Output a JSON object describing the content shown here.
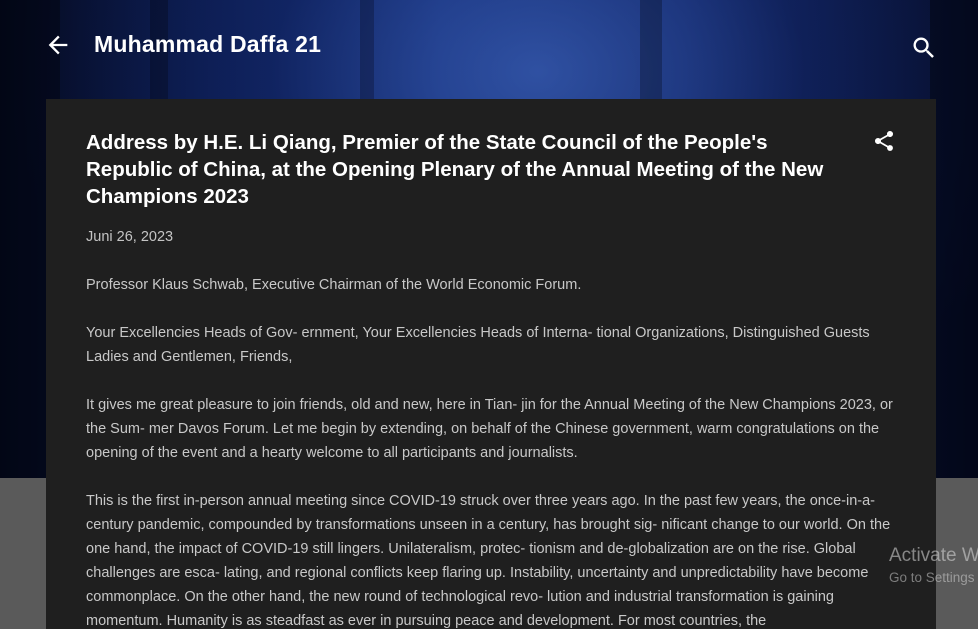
{
  "blog": {
    "title": "Muhammad Daffa 21"
  },
  "post": {
    "title": "Address by H.E. Li Qiang, Premier of the State Council of the People's Republic of China, at the Opening Plenary of the Annual Meeting of the New Champions 2023",
    "date": "Juni 26, 2023",
    "paragraphs": [
      "Professor Klaus Schwab, Executive Chairman of the World Economic Forum.",
      "Your Excellencies Heads of Gov- ernment, Your Excellencies Heads of Interna- tional Organizations, Distinguished Guests Ladies and Gentlemen, Friends,",
      "It gives me great pleasure to join friends, old and new, here in Tian- jin for the Annual Meeting of the New Champions 2023, or the Sum- mer Davos Forum. Let me begin by extending, on behalf of the Chinese government, warm congratulations on the opening of the event and a hearty welcome to all participants and journalists.",
      "This is the first in-person annual meeting since COVID-19 struck over three years ago. In the past few years, the once-in-a-century pandemic, compounded by transformations unseen in a century, has brought sig- nificant change to our world. On the one hand, the impact of COVID-19 still lingers. Unilateralism, protec- tionism and de-globalization are on the rise. Global challenges are esca- lating, and regional conflicts keep flaring up. Instability, uncertainty and unpredictability have become commonplace. On the other hand, the new round of technological revo- lution and industrial transformation is gaining momentum. Humanity is as steadfast as ever in pursuing peace and development. For most countries, the"
    ]
  },
  "watermark": {
    "title": "Activate Windows",
    "subtitle": "Go to Settings to activate Windows."
  },
  "icons": {
    "back": "arrow-back-icon",
    "search": "search-icon",
    "share": "share-icon"
  }
}
